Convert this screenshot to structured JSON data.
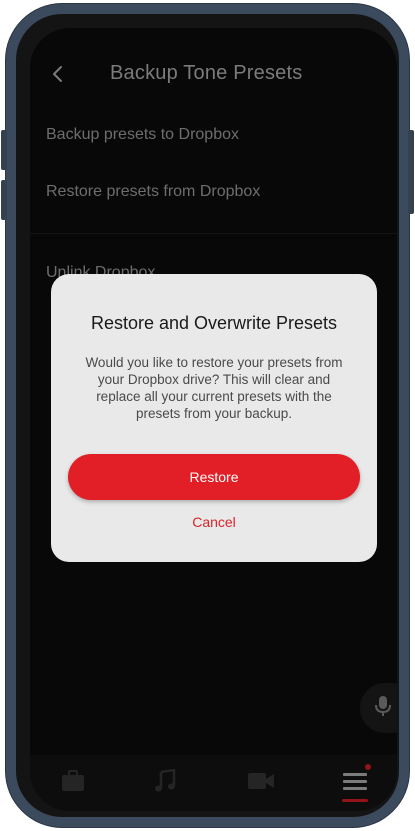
{
  "header": {
    "title": "Backup Tone Presets",
    "back_icon": "chevron-left-icon"
  },
  "menu": {
    "items": [
      {
        "label": "Backup presets to Dropbox"
      },
      {
        "label": "Restore presets from Dropbox"
      },
      {
        "label": "Unlink Dropbox"
      }
    ]
  },
  "dialog": {
    "title": "Restore and Overwrite Presets",
    "body": "Would you like to restore your presets from your Dropbox drive? This will clear and replace all your current presets with the presets from your backup.",
    "confirm_label": "Restore",
    "cancel_label": "Cancel"
  },
  "fab": {
    "icon": "microphone-icon"
  },
  "bottom_nav": {
    "items": [
      {
        "icon": "briefcase-icon"
      },
      {
        "icon": "music-note-icon"
      },
      {
        "icon": "video-camera-icon"
      },
      {
        "icon": "hamburger-menu-icon",
        "active": true,
        "has_badge": true
      }
    ]
  },
  "colors": {
    "accent": "#e21f26",
    "background": "#0d0d0d",
    "dialog_background": "#e9e9e9",
    "device_frame": "#3b4a5c"
  }
}
